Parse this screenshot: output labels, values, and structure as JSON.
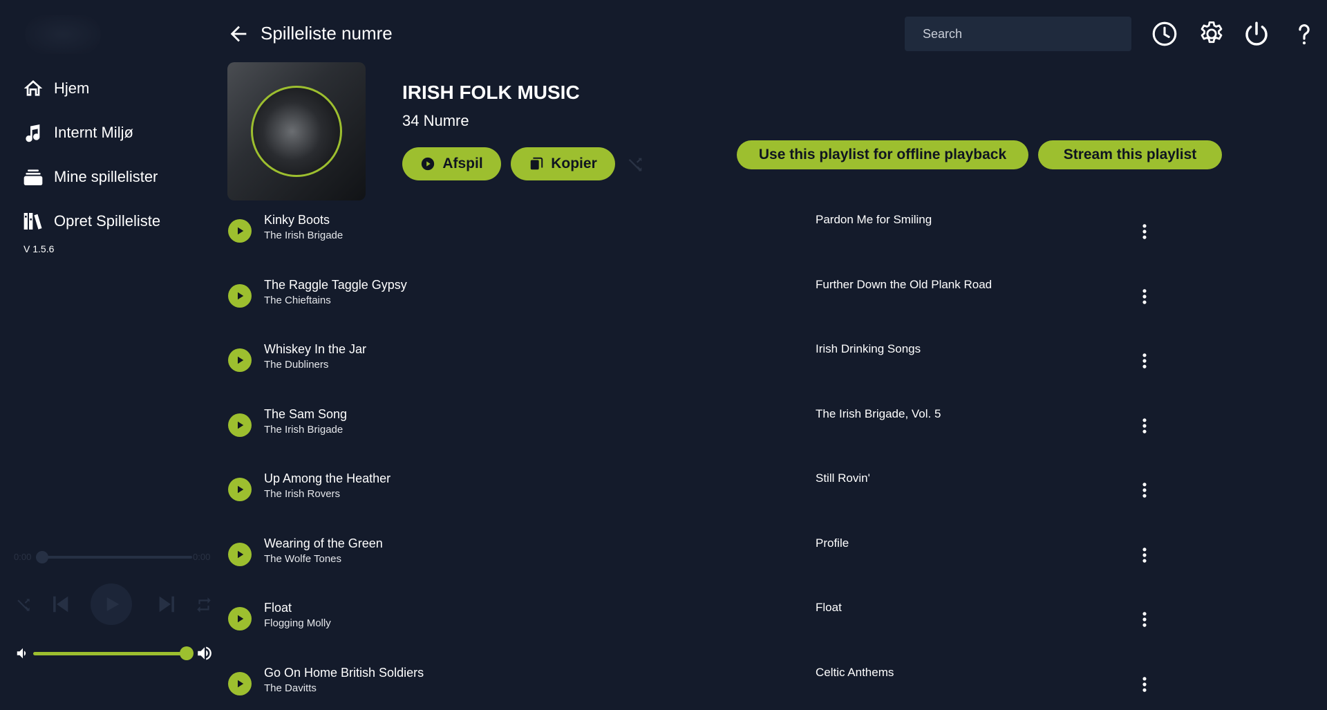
{
  "app": {
    "header_title": "Spilleliste numre",
    "version": "V 1.5.6"
  },
  "sidebar": {
    "items": [
      {
        "label": "Hjem",
        "icon": "home-icon"
      },
      {
        "label": "Internt Miljø",
        "icon": "music-note-icon"
      },
      {
        "label": "Mine spillelister",
        "icon": "stack-icon"
      },
      {
        "label": "Opret Spilleliste",
        "icon": "library-icon"
      }
    ]
  },
  "player": {
    "time_current": "0:00",
    "time_total": "0:00",
    "progress": 0,
    "volume": 0.95
  },
  "search": {
    "placeholder": "Search"
  },
  "playlist": {
    "name": "IRISH FOLK MUSIC",
    "count_label": "34 Numre",
    "play_label": "Afspil",
    "copy_label": "Kopier",
    "offline_label": "Use this playlist for offline playback",
    "stream_label": "Stream this playlist"
  },
  "tracks": [
    {
      "title": "Kinky Boots",
      "artist": "The Irish Brigade",
      "album": "Pardon Me for Smiling"
    },
    {
      "title": "The Raggle Taggle Gypsy",
      "artist": "The Chieftains",
      "album": "Further Down the Old Plank Road"
    },
    {
      "title": "Whiskey In the Jar",
      "artist": "The Dubliners",
      "album": "Irish Drinking Songs"
    },
    {
      "title": "The Sam Song",
      "artist": "The Irish Brigade",
      "album": "The Irish Brigade, Vol. 5"
    },
    {
      "title": "Up Among the Heather",
      "artist": "The Irish Rovers",
      "album": "Still Rovin'"
    },
    {
      "title": "Wearing of the Green",
      "artist": "The Wolfe Tones",
      "album": "Profile"
    },
    {
      "title": "Float",
      "artist": "Flogging Molly",
      "album": "Float"
    },
    {
      "title": "Go On Home British Soldiers",
      "artist": "The Davitts",
      "album": "Celtic Anthems"
    }
  ],
  "colors": {
    "background": "#141b2b",
    "accent": "#9dbf2f",
    "search_bg": "#1f2a3d"
  }
}
